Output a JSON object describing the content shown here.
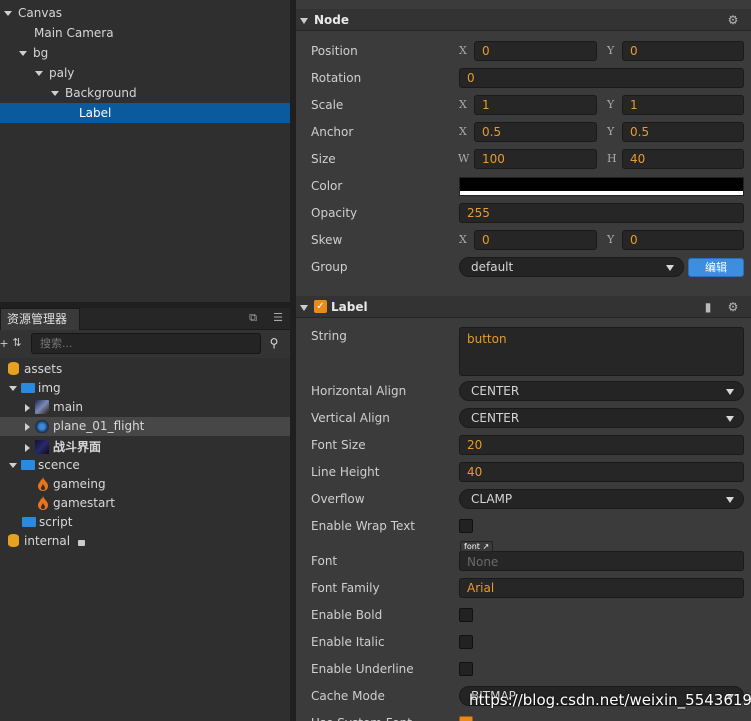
{
  "hierarchy": {
    "items": [
      {
        "label": "Canvas"
      },
      {
        "label": "Main Camera"
      },
      {
        "label": "bg"
      },
      {
        "label": "paly"
      },
      {
        "label": "Background"
      },
      {
        "label": "Label"
      }
    ]
  },
  "assets_panel": {
    "title": "资源管理器",
    "search_placeholder": "搜索...",
    "items": [
      {
        "label": "assets"
      },
      {
        "label": "img"
      },
      {
        "label": "main"
      },
      {
        "label": "plane_01_flight"
      },
      {
        "label": "战斗界面"
      },
      {
        "label": "scence"
      },
      {
        "label": "gameing"
      },
      {
        "label": "gamestart"
      },
      {
        "label": "script"
      },
      {
        "label": "internal"
      }
    ],
    "icons": {
      "folder_color": "#2a8ae0",
      "db_color": "#e6a21c",
      "flame_color": "#e8741c"
    }
  },
  "node_section": {
    "title": "Node",
    "position": {
      "label": "Position",
      "x_axis": "X",
      "x": "0",
      "y_axis": "Y",
      "y": "0"
    },
    "rotation": {
      "label": "Rotation",
      "value": "0"
    },
    "scale": {
      "label": "Scale",
      "x_axis": "X",
      "x": "1",
      "y_axis": "Y",
      "y": "1"
    },
    "anchor": {
      "label": "Anchor",
      "x_axis": "X",
      "x": "0.5",
      "y_axis": "Y",
      "y": "0.5"
    },
    "size": {
      "label": "Size",
      "w_axis": "W",
      "w": "100",
      "h_axis": "H",
      "h": "40"
    },
    "color": {
      "label": "Color",
      "value_hex": "#000000"
    },
    "opacity": {
      "label": "Opacity",
      "value": "255"
    },
    "skew": {
      "label": "Skew",
      "x_axis": "X",
      "x": "0",
      "y_axis": "Y",
      "y": "0"
    },
    "group": {
      "label": "Group",
      "value": "default",
      "edit_button": "编辑"
    }
  },
  "label_section": {
    "title": "Label",
    "enabled": true,
    "string": {
      "label": "String",
      "value": "button"
    },
    "horizontal_align": {
      "label": "Horizontal Align",
      "value": "CENTER"
    },
    "vertical_align": {
      "label": "Vertical Align",
      "value": "CENTER"
    },
    "font_size": {
      "label": "Font Size",
      "value": "20"
    },
    "line_height": {
      "label": "Line Height",
      "value": "40"
    },
    "overflow": {
      "label": "Overflow",
      "value": "CLAMP"
    },
    "enable_wrap_text": {
      "label": "Enable Wrap Text",
      "checked": false
    },
    "font": {
      "label": "Font",
      "tag": "font",
      "value": "None"
    },
    "font_family": {
      "label": "Font Family",
      "value": "Arial"
    },
    "enable_bold": {
      "label": "Enable Bold",
      "checked": false
    },
    "enable_italic": {
      "label": "Enable Italic",
      "checked": false
    },
    "enable_underline": {
      "label": "Enable Underline",
      "checked": false
    },
    "cache_mode": {
      "label": "Cache Mode",
      "value": "BITMAP"
    },
    "use_system_font": {
      "label": "Use System Font"
    }
  },
  "watermark": "https://blog.csdn.net/weixin_55436193",
  "colors": {
    "accent": "#e89b2c",
    "selection": "#0c5a9e",
    "edit_button": "#3b8ee0"
  }
}
